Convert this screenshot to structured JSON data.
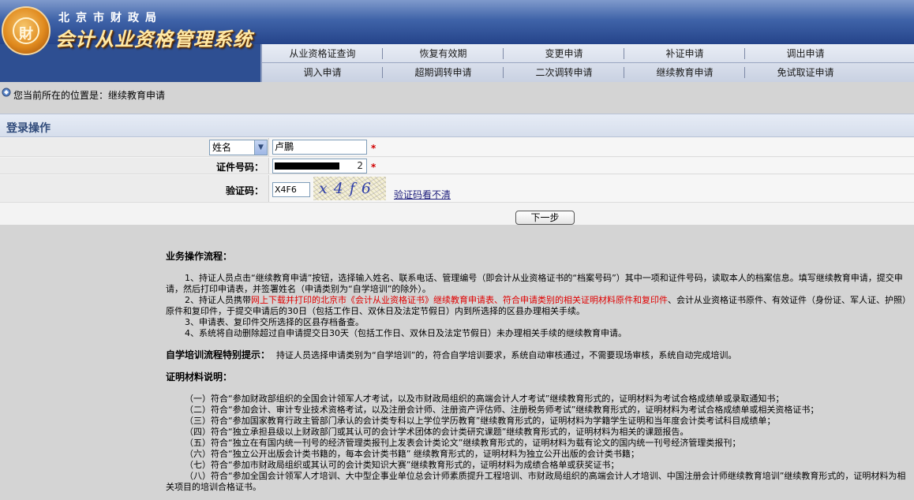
{
  "header": {
    "org_name": "北京市财政局",
    "system_name": "会计从业资格管理系统",
    "logo_glyph": "財"
  },
  "nav": {
    "row1": [
      "从业资格证查询",
      "恢复有效期",
      "变更申请",
      "补证申请",
      "调出申请"
    ],
    "row2": [
      "调入申请",
      "超期调转申请",
      "二次调转申请",
      "继续教育申请",
      "免试取证申请"
    ]
  },
  "breadcrumb": {
    "text": "您当前所在的位置是：继续教育申请"
  },
  "login": {
    "title": "登录操作",
    "type_select": "姓名",
    "name_value": "卢鵬",
    "id_label": "证件号码：",
    "id_value_visible": "2",
    "captcha_label": "验证码：",
    "captcha_input": "X4F6",
    "captcha_image_text": "x4f6",
    "captcha_refresh": "验证码看不清",
    "required_mark": "*",
    "next_button": "下一步"
  },
  "instructions": {
    "process_heading": "业务操作流程：",
    "p1": "1、持证人员点击“继续教育申请”按钮，选择输入姓名、联系电话、管理编号（即会计从业资格证书的“档案号码”）其中一项和证件号码，读取本人的档案信息。填写继续教育申请，提交申请，然后打印申请表，并签署姓名（申请类别为“自学培训”的除外）。",
    "p2_pre": "2、持证人员携带",
    "p2_red": "网上下载并打印的北京市《会计从业资格证书》继续教育申请表、符合申请类别的相关证明材料原件和复印件",
    "p2_post": "、会计从业资格证书原件、有效证件（身份证、军人证、护照）原件和复印件，于提交申请后的30日（包括工作日、双休日及法定节假日）内到所选择的区县办理相关手续。",
    "p3": "3、申请表、复印件交所选择的区县存档备查。",
    "p4": "4、系统将自动删除超过自申请提交日30天（包括工作日、双休日及法定节假日）未办理相关手续的继续教育申请。",
    "selfstudy_heading": "自学培训流程特别提示：",
    "selfstudy_text": "持证人员选择申请类别为“自学培训”的，符合自学培训要求，系统自动审核通过，不需要现场审核，系统自动完成培训。",
    "materials_heading": "证明材料说明：",
    "materials": [
      "（一）符合“参加财政部组织的全国会计领军人才考试，以及市财政局组织的高端会计人才考试”继续教育形式的，证明材料为考试合格成绩单或录取通知书；",
      "（二）符合“参加会计、审计专业技术资格考试，以及注册会计师、注册资产评估师、注册税务师考试”继续教育形式的，证明材料为考试合格成绩单或相关资格证书；",
      "（三）符合“参加国家教育行政主管部门承认的会计类专科以上学位学历教育”继续教育形式的，证明材料为学籍学生证明和当年度会计类考试科目成绩单；",
      "（四）符合“独立承担县级以上财政部门或其认可的会计学术团体的会计类研究课题”继续教育形式的，证明材料为相关的课题报告。",
      "（五）符合“独立在有国内统一刊号的经济管理类报刊上发表会计类论文”继续教育形式的，证明材料为载有论文的国内统一刊号经济管理类报刊；",
      "（六）符合“独立公开出版会计类书籍的，每本会计类书籍” 继续教育形式的，证明材料为独立公开出版的会计类书籍；",
      "（七）符合“参加市财政局组织或其认可的会计类知识大赛”继续教育形式的，证明材料为成绩合格单或获奖证书；",
      "（八）符合“参加全国会计领军人才培训、大中型企事业单位总会计师素质提升工程培训、市财政局组织的高端会计人才培训、中国注册会计师继续教育培训”继续教育形式的，证明材料为相关项目的培训合格证书。"
    ]
  },
  "colors": {
    "header_blue": "#2e4f92",
    "title_blue": "#2f4a7a",
    "required_red": "#d00000",
    "highlight_red": "#e00000"
  }
}
